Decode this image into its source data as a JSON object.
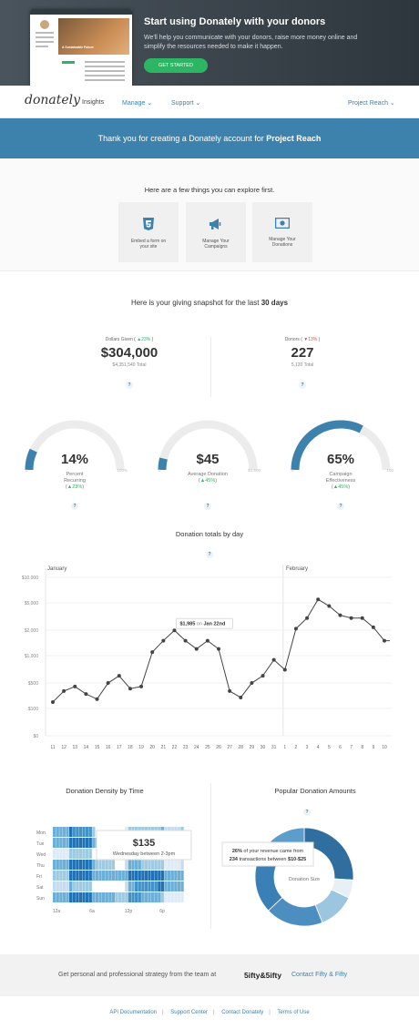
{
  "hero": {
    "title": "Start using Donately with your donors",
    "text": "We'll help you communicate with your donors, raise more money online and simplify the resources needed to make it happen.",
    "button": "GET STARTED",
    "preview_caption": "A Sustainable Future"
  },
  "nav": {
    "logo": "donately",
    "insights": "Insights",
    "manage": "Manage",
    "support": "Support",
    "project": "Project Reach"
  },
  "banner": {
    "text": "Thank you for creating a Donately account for",
    "project": "Project Reach"
  },
  "explore": {
    "heading": "Here are a few things you can explore first.",
    "cards": [
      {
        "icon": "html5-icon",
        "label": "Embed a form on your site"
      },
      {
        "icon": "megaphone-icon",
        "label": "Manage Your Campaigns"
      },
      {
        "icon": "money-icon",
        "label": "Manage Your Donations"
      }
    ]
  },
  "snapshot": {
    "heading_pre": "Here is your giving snapshot for the last",
    "heading_bold": "30 days"
  },
  "metrics": {
    "dollars": {
      "label": "Dollars Given",
      "change": "23%",
      "trend": "up",
      "value": "$304,000",
      "total": "$4,351,540 Total"
    },
    "donors": {
      "label": "Donors",
      "change": "13%",
      "trend": "down",
      "value": "227",
      "total": "5,120 Total"
    }
  },
  "gauges": [
    {
      "value": "14%",
      "label": "Percent Recurring",
      "change": "23%",
      "min": "0",
      "max": "100%",
      "fraction": 0.14
    },
    {
      "value": "$45",
      "label": "Average Donation",
      "change": "45%",
      "min": "0",
      "max": "$1,500",
      "fraction": 0.03
    },
    {
      "value": "65%",
      "label": "Campaign Effectiveness",
      "change": "45%",
      "min": "0",
      "max": "100",
      "fraction": 0.65
    }
  ],
  "chart_data": {
    "type": "line",
    "title": "Donation totals by day",
    "month_labels": [
      "January",
      "February"
    ],
    "x": [
      "11",
      "12",
      "13",
      "14",
      "15",
      "16",
      "17",
      "18",
      "19",
      "20",
      "21",
      "22",
      "23",
      "24",
      "25",
      "26",
      "27",
      "28",
      "29",
      "30",
      "31",
      "1",
      "2",
      "3",
      "4",
      "5",
      "6",
      "7",
      "8",
      "9",
      "10"
    ],
    "y_ticks": [
      "$10,000",
      "$5,000",
      "$2,000",
      "$1,000",
      "$500",
      "$100",
      "$0"
    ],
    "y_scale": "log",
    "values": [
      150,
      300,
      400,
      250,
      180,
      500,
      600,
      350,
      400,
      1100,
      1500,
      1985,
      1500,
      1200,
      1500,
      1200,
      300,
      200,
      500,
      600,
      900,
      700,
      2100,
      3000,
      5500,
      4500,
      3300,
      3000,
      3000,
      2200,
      1500
    ],
    "annotation": {
      "value": "$1,985",
      "on": "on",
      "date": "Jan 22nd"
    }
  },
  "density": {
    "title": "Donation Density by Time",
    "days": [
      "Mon",
      "Tue",
      "Wed",
      "Thu",
      "Fri",
      "Sat",
      "Sun"
    ],
    "hours": [
      "12a",
      "6a",
      "12p",
      "6p"
    ],
    "tooltip_value": "$135",
    "tooltip_text": "Wednesday between 2-3pm"
  },
  "amounts": {
    "title": "Popular Donation Amounts",
    "tooltip_pct": "26%",
    "tooltip_mid": "of your revenue came from",
    "tooltip_count": "234",
    "tooltip_tail": "transactions between",
    "tooltip_range": "$10-$25",
    "center": "Donation Size"
  },
  "footer": {
    "text": "Get personal and professional strategy from the team at",
    "brand": "5ifty&5ifty",
    "link": "Contact Fifty & Fifty",
    "links": [
      "API Documentation",
      "Support Center",
      "Contact Donately",
      "Terms of Use"
    ]
  },
  "colors": {
    "accent": "#3d82ad",
    "green": "#2cb563",
    "red": "#d9534f"
  }
}
